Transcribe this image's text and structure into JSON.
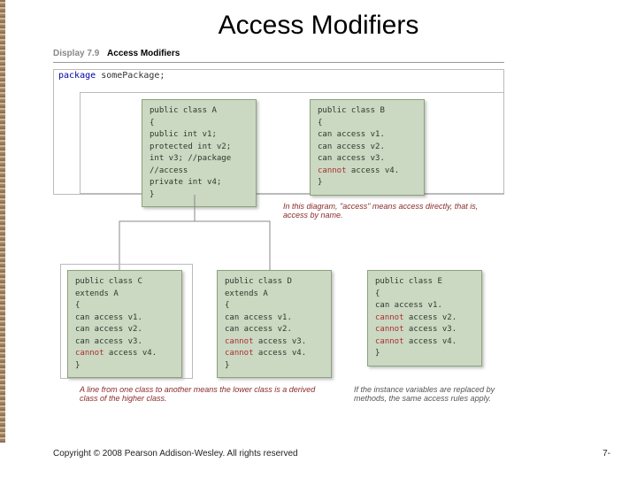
{
  "title": "Access Modifiers",
  "display": {
    "num": "Display 7.9",
    "name": "Access Modifiers"
  },
  "package": {
    "kw": "package",
    "name": "somePackage;"
  },
  "boxA": {
    "l1": "public class A",
    "l2": "{",
    "l3": "  public int v1;",
    "l4": "  protected int v2;",
    "l5": "  int v3; //package",
    "l6": "         //access",
    "l7": "  private int v4;",
    "l8": "}"
  },
  "boxB": {
    "l1": "public class B",
    "l2": "{",
    "l3": "  can access v1.",
    "l4": "  can access v2.",
    "l5": "  can access v3.",
    "l6_a": "  ",
    "l6_b": "cannot",
    "l6_c": " access v4.",
    "l7": "}"
  },
  "boxC": {
    "l1": "public class C",
    "l2": "       extends A",
    "l3": "{",
    "l4": "  can access v1.",
    "l5": "  can access v2.",
    "l6": "  can access v3.",
    "l7_a": "  ",
    "l7_b": "cannot",
    "l7_c": " access v4.",
    "l8": "}"
  },
  "boxD": {
    "l1": "public class D",
    "l2": "       extends A",
    "l3": "{",
    "l4": "  can access v1.",
    "l5": "  can access v2.",
    "l6_a": "  ",
    "l6_b": "cannot",
    "l6_c": " access v3.",
    "l7_a": "  ",
    "l7_b": "cannot",
    "l7_c": " access v4.",
    "l8": "}"
  },
  "boxE": {
    "l1": "public class E",
    "l2": "{",
    "l3": "  can access v1.",
    "l4_a": "  ",
    "l4_b": "cannot",
    "l4_c": " access v2.",
    "l5_a": "  ",
    "l5_b": "cannot",
    "l5_c": " access v3.",
    "l6_a": "  ",
    "l6_b": "cannot",
    "l6_c": " access v4.",
    "l7": "}"
  },
  "caption_diagram": "In this diagram, \"access\" means access directly, that is, access by name.",
  "caption_line": "A line from one class to another means the lower class is a derived class of the higher class.",
  "caption_methods": "If the instance variables are replaced by methods, the same access rules apply.",
  "copyright": "Copyright © 2008 Pearson Addison-Wesley. All rights reserved",
  "pagenum": "7-"
}
